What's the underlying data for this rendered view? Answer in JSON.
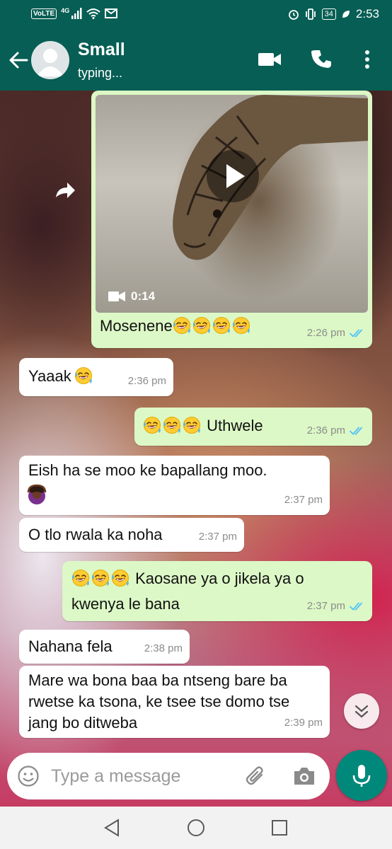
{
  "status_bar": {
    "volte": "VoLTE",
    "network": "4G",
    "battery": "34",
    "time": "2:53"
  },
  "header": {
    "contact_name": "Small",
    "contact_status": "typing..."
  },
  "messages": [
    {
      "type": "video",
      "direction": "outgoing",
      "duration": "0:14",
      "caption": "Mosenene",
      "emoji_count": 4,
      "time": "2:26 pm",
      "read": true
    },
    {
      "type": "text",
      "direction": "incoming",
      "text": "Yaaak",
      "emoji_after": 1,
      "time": "2:36 pm"
    },
    {
      "type": "text",
      "direction": "outgoing",
      "emoji_before": 3,
      "text": "Uthwele",
      "time": "2:36 pm",
      "read": true
    },
    {
      "type": "text",
      "direction": "incoming",
      "text": "Eish ha se moo ke bapallang moo.",
      "extra_emoji": "person-gesturing-ok",
      "time": "2:37 pm"
    },
    {
      "type": "text",
      "direction": "incoming",
      "text": "O tlo rwala ka noha",
      "time": "2:37 pm"
    },
    {
      "type": "text",
      "direction": "outgoing",
      "emoji_before": 3,
      "text_line1": "Kaosane ya o jikela ya o",
      "text_line2": "kwenya le bana",
      "time": "2:37 pm",
      "read": true
    },
    {
      "type": "text",
      "direction": "incoming",
      "text": "Nahana fela",
      "time": "2:38 pm"
    },
    {
      "type": "text",
      "direction": "incoming",
      "text_line1": "Mare wa bona baa ba ntseng bare ba",
      "text_line2": "rwetse ka tsona, ke tsee tse domo tse",
      "text_line3": "jang bo ditweba",
      "time": "2:39 pm"
    }
  ],
  "composer": {
    "placeholder": "Type a message"
  },
  "colors": {
    "header": "#075e54",
    "outgoing_bubble": "#dcf8c6",
    "incoming_bubble": "#ffffff",
    "read_ticks": "#4fc3f7",
    "mic_button": "#00897b"
  }
}
